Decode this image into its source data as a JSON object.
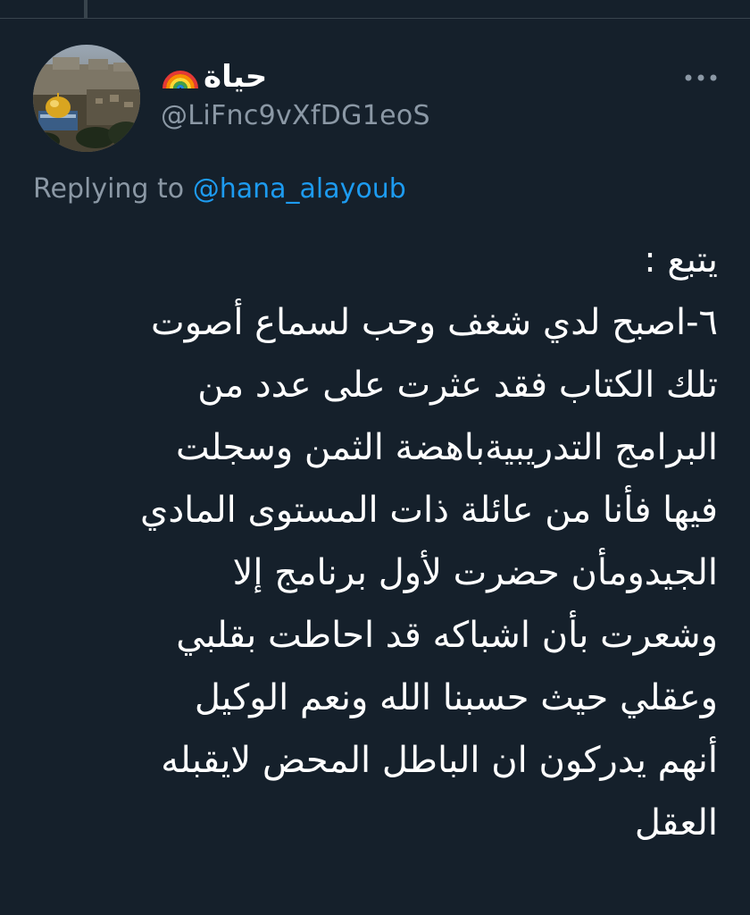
{
  "tweet": {
    "author": {
      "display_name": "حياة",
      "name_emoji": "rainbow-icon",
      "handle": "@LiFnc9vXfDG1eoS"
    },
    "reply_context": {
      "prefix": "Replying to",
      "mention": "@hana_alayoub"
    },
    "text_lines": [
      "يتبع :",
      "٦-اصبح لدي شغف وحب لسماع أصوت",
      "تلك الكتاب فقد عثرت على عدد من",
      "البرامج التدريبيةباهضة الثمن وسجلت",
      "فيها فأنا من عائلة ذات المستوى المادي",
      "الجيدومأن حضرت لأول برنامج إلا",
      "وشعرت بأن اشباكه قد احاطت بقلبي",
      "وعقلي حيث حسبنا الله ونعم الوكيل",
      "أنهم يدركون ان الباطل المحض لايقبله",
      "العقل"
    ]
  },
  "icons": {
    "more": "more-horizontal-icon",
    "avatar": "avatar-image"
  },
  "colors": {
    "background": "#15202b",
    "text_primary": "#ffffff",
    "text_secondary": "#8b98a5",
    "accent": "#1d9bf0"
  }
}
